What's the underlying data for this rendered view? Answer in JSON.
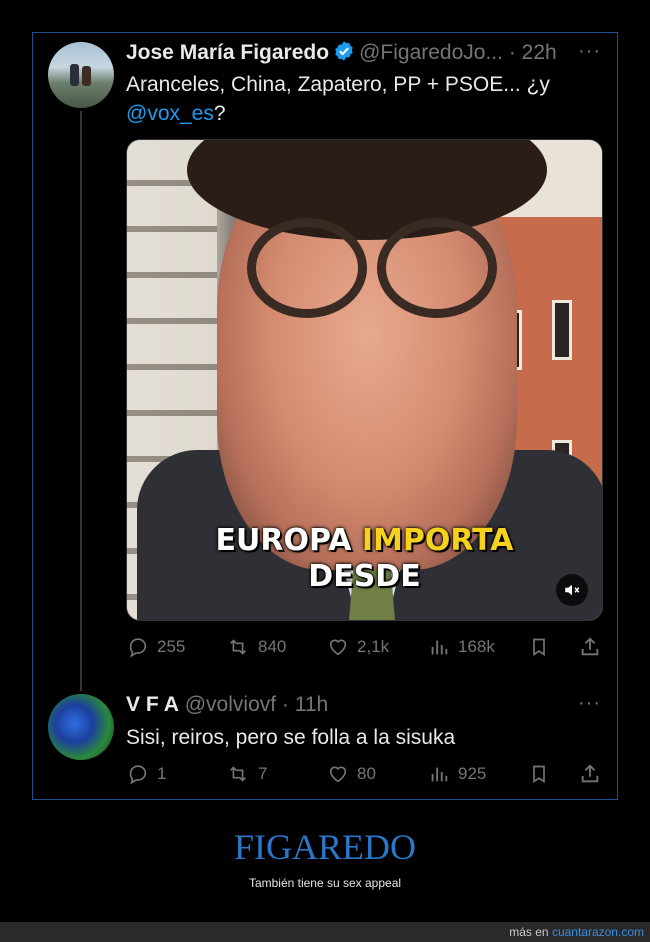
{
  "tweet": {
    "author_name": "Jose María Figaredo",
    "handle": "@FigaredoJo...",
    "time": "· 22h",
    "text": "Aranceles, China, Zapatero, PP + PSOE... ¿y",
    "mention": "@vox_es",
    "text_after_mention": "?",
    "video_caption_line1_a": "EUROPA",
    "video_caption_line1_b": "IMPORTA",
    "video_caption_line2": "DESDE",
    "stats": {
      "replies": "255",
      "retweets": "840",
      "likes": "2,1k",
      "views": "168k"
    }
  },
  "reply": {
    "author_name": "V F A",
    "handle": "@volviovf",
    "time": "· 11h",
    "text": "Sisi, reiros, pero se folla a la sisuka",
    "stats": {
      "replies": "1",
      "retweets": "7",
      "likes": "80",
      "views": "925"
    }
  },
  "more_glyph": "···",
  "footer": {
    "title": "FIGAREDO",
    "subtitle": "También tiene su sex appeal",
    "source_prefix": "más en",
    "source_link": "cuantarazon.com"
  },
  "colors": {
    "accent": "#1d9bf0",
    "frame_border": "#1d4e8f",
    "footer_title": "#2a77c9",
    "muted": "#71767b"
  }
}
